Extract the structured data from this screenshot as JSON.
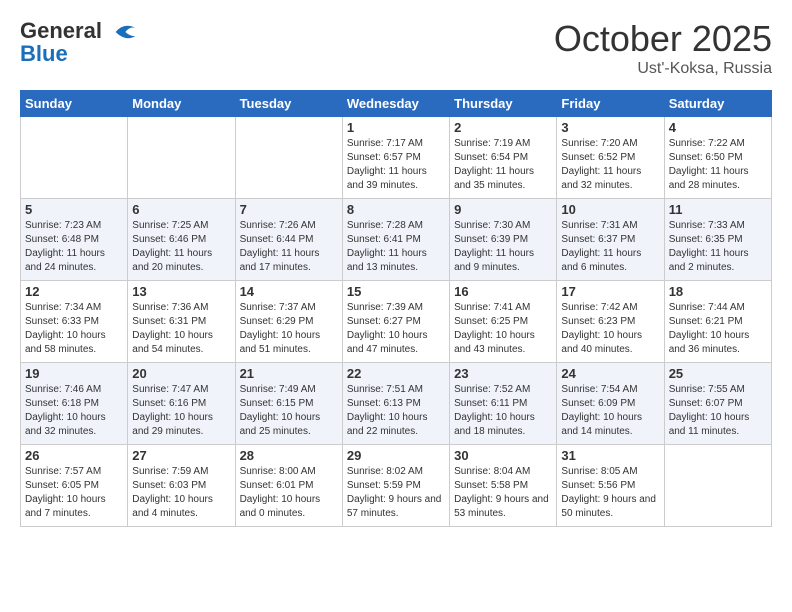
{
  "header": {
    "logo_general": "General",
    "logo_blue": "Blue",
    "month": "October 2025",
    "location": "Ust'-Koksa, Russia"
  },
  "weekdays": [
    "Sunday",
    "Monday",
    "Tuesday",
    "Wednesday",
    "Thursday",
    "Friday",
    "Saturday"
  ],
  "weeks": [
    [
      {
        "day": "",
        "info": ""
      },
      {
        "day": "",
        "info": ""
      },
      {
        "day": "",
        "info": ""
      },
      {
        "day": "1",
        "info": "Sunrise: 7:17 AM\nSunset: 6:57 PM\nDaylight: 11 hours and 39 minutes."
      },
      {
        "day": "2",
        "info": "Sunrise: 7:19 AM\nSunset: 6:54 PM\nDaylight: 11 hours and 35 minutes."
      },
      {
        "day": "3",
        "info": "Sunrise: 7:20 AM\nSunset: 6:52 PM\nDaylight: 11 hours and 32 minutes."
      },
      {
        "day": "4",
        "info": "Sunrise: 7:22 AM\nSunset: 6:50 PM\nDaylight: 11 hours and 28 minutes."
      }
    ],
    [
      {
        "day": "5",
        "info": "Sunrise: 7:23 AM\nSunset: 6:48 PM\nDaylight: 11 hours and 24 minutes."
      },
      {
        "day": "6",
        "info": "Sunrise: 7:25 AM\nSunset: 6:46 PM\nDaylight: 11 hours and 20 minutes."
      },
      {
        "day": "7",
        "info": "Sunrise: 7:26 AM\nSunset: 6:44 PM\nDaylight: 11 hours and 17 minutes."
      },
      {
        "day": "8",
        "info": "Sunrise: 7:28 AM\nSunset: 6:41 PM\nDaylight: 11 hours and 13 minutes."
      },
      {
        "day": "9",
        "info": "Sunrise: 7:30 AM\nSunset: 6:39 PM\nDaylight: 11 hours and 9 minutes."
      },
      {
        "day": "10",
        "info": "Sunrise: 7:31 AM\nSunset: 6:37 PM\nDaylight: 11 hours and 6 minutes."
      },
      {
        "day": "11",
        "info": "Sunrise: 7:33 AM\nSunset: 6:35 PM\nDaylight: 11 hours and 2 minutes."
      }
    ],
    [
      {
        "day": "12",
        "info": "Sunrise: 7:34 AM\nSunset: 6:33 PM\nDaylight: 10 hours and 58 minutes."
      },
      {
        "day": "13",
        "info": "Sunrise: 7:36 AM\nSunset: 6:31 PM\nDaylight: 10 hours and 54 minutes."
      },
      {
        "day": "14",
        "info": "Sunrise: 7:37 AM\nSunset: 6:29 PM\nDaylight: 10 hours and 51 minutes."
      },
      {
        "day": "15",
        "info": "Sunrise: 7:39 AM\nSunset: 6:27 PM\nDaylight: 10 hours and 47 minutes."
      },
      {
        "day": "16",
        "info": "Sunrise: 7:41 AM\nSunset: 6:25 PM\nDaylight: 10 hours and 43 minutes."
      },
      {
        "day": "17",
        "info": "Sunrise: 7:42 AM\nSunset: 6:23 PM\nDaylight: 10 hours and 40 minutes."
      },
      {
        "day": "18",
        "info": "Sunrise: 7:44 AM\nSunset: 6:21 PM\nDaylight: 10 hours and 36 minutes."
      }
    ],
    [
      {
        "day": "19",
        "info": "Sunrise: 7:46 AM\nSunset: 6:18 PM\nDaylight: 10 hours and 32 minutes."
      },
      {
        "day": "20",
        "info": "Sunrise: 7:47 AM\nSunset: 6:16 PM\nDaylight: 10 hours and 29 minutes."
      },
      {
        "day": "21",
        "info": "Sunrise: 7:49 AM\nSunset: 6:15 PM\nDaylight: 10 hours and 25 minutes."
      },
      {
        "day": "22",
        "info": "Sunrise: 7:51 AM\nSunset: 6:13 PM\nDaylight: 10 hours and 22 minutes."
      },
      {
        "day": "23",
        "info": "Sunrise: 7:52 AM\nSunset: 6:11 PM\nDaylight: 10 hours and 18 minutes."
      },
      {
        "day": "24",
        "info": "Sunrise: 7:54 AM\nSunset: 6:09 PM\nDaylight: 10 hours and 14 minutes."
      },
      {
        "day": "25",
        "info": "Sunrise: 7:55 AM\nSunset: 6:07 PM\nDaylight: 10 hours and 11 minutes."
      }
    ],
    [
      {
        "day": "26",
        "info": "Sunrise: 7:57 AM\nSunset: 6:05 PM\nDaylight: 10 hours and 7 minutes."
      },
      {
        "day": "27",
        "info": "Sunrise: 7:59 AM\nSunset: 6:03 PM\nDaylight: 10 hours and 4 minutes."
      },
      {
        "day": "28",
        "info": "Sunrise: 8:00 AM\nSunset: 6:01 PM\nDaylight: 10 hours and 0 minutes."
      },
      {
        "day": "29",
        "info": "Sunrise: 8:02 AM\nSunset: 5:59 PM\nDaylight: 9 hours and 57 minutes."
      },
      {
        "day": "30",
        "info": "Sunrise: 8:04 AM\nSunset: 5:58 PM\nDaylight: 9 hours and 53 minutes."
      },
      {
        "day": "31",
        "info": "Sunrise: 8:05 AM\nSunset: 5:56 PM\nDaylight: 9 hours and 50 minutes."
      },
      {
        "day": "",
        "info": ""
      }
    ]
  ]
}
